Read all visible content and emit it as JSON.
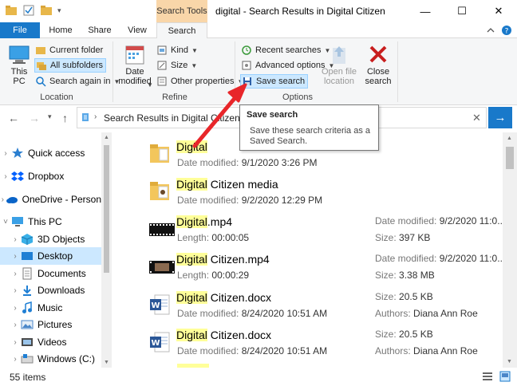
{
  "titlebar": {
    "context_tab": "Search Tools",
    "title": "digital - Search Results in Digital Citizen",
    "minimize": "—",
    "maximize": "☐",
    "close": "✕"
  },
  "tabs": {
    "file": "File",
    "home": "Home",
    "share": "Share",
    "view": "View",
    "search": "Search"
  },
  "ribbon": {
    "location": {
      "this_pc": "This PC",
      "current_folder": "Current folder",
      "all_subfolders": "All subfolders",
      "search_again_in": "Search again in",
      "group_label": "Location"
    },
    "refine": {
      "date_modified": "Date modified",
      "kind": "Kind",
      "size": "Size",
      "other_properties": "Other properties",
      "group_label": "Refine"
    },
    "options": {
      "recent_searches": "Recent searches",
      "advanced_options": "Advanced options",
      "save_search": "Save search",
      "open_file_location": "Open file location",
      "close_search": "Close search",
      "group_label": "Options"
    }
  },
  "address": {
    "path": "Search Results in Digital Citizen"
  },
  "tooltip": {
    "title": "Save search",
    "description": "Save these search criteria as a Saved Search."
  },
  "nav": {
    "items": [
      {
        "label": "Quick access",
        "icon": "star-icon"
      },
      {
        "label": "Dropbox",
        "icon": "dropbox-icon"
      },
      {
        "label": "OneDrive - Person",
        "icon": "cloud-icon"
      },
      {
        "label": "This PC",
        "icon": "computer-icon"
      },
      {
        "label": "3D Objects",
        "icon": "cube-icon"
      },
      {
        "label": "Desktop",
        "icon": "desktop-icon"
      },
      {
        "label": "Documents",
        "icon": "document-icon"
      },
      {
        "label": "Downloads",
        "icon": "download-icon"
      },
      {
        "label": "Music",
        "icon": "music-icon"
      },
      {
        "label": "Pictures",
        "icon": "picture-icon"
      },
      {
        "label": "Videos",
        "icon": "video-icon"
      },
      {
        "label": "Windows (C:)",
        "icon": "drive-icon"
      }
    ]
  },
  "results": [
    {
      "highlight": "Digital",
      "rest": "",
      "sub_label": "Date modified:",
      "sub_value": "9/1/2020 3:26 PM",
      "right1_label": "",
      "right1_value": "",
      "right2_label": "",
      "right2_value": "",
      "icon": "folder-icon"
    },
    {
      "highlight": "Digital",
      "rest": " Citizen media",
      "sub_label": "Date modified:",
      "sub_value": "9/2/2020 12:29 PM",
      "right1_label": "",
      "right1_value": "",
      "right2_label": "",
      "right2_value": "",
      "icon": "folder-media-icon"
    },
    {
      "highlight": "Digital",
      "rest": ".mp4",
      "sub_label": "Length:",
      "sub_value": "00:00:05",
      "right1_label": "Date modified:",
      "right1_value": "9/2/2020 11:0...",
      "right2_label": "Size:",
      "right2_value": "397 KB",
      "icon": "video-file-icon"
    },
    {
      "highlight": "Digital",
      "rest": " Citizen.mp4",
      "sub_label": "Length:",
      "sub_value": "00:00:29",
      "right1_label": "Date modified:",
      "right1_value": "9/2/2020 11:0...",
      "right2_label": "Size:",
      "right2_value": "3.38 MB",
      "icon": "video-file-icon"
    },
    {
      "highlight": "Digital",
      "rest": " Citizen.docx",
      "sub_label": "Date modified:",
      "sub_value": "8/24/2020 10:51 AM",
      "right1_label": "Size:",
      "right1_value": "20.5 KB",
      "right2_label": "Authors:",
      "right2_value": "Diana Ann Roe",
      "icon": "word-doc-icon"
    },
    {
      "highlight": "Digital",
      "rest": " Citizen.docx",
      "sub_label": "Date modified:",
      "sub_value": "8/24/2020 10:51 AM",
      "right1_label": "Size:",
      "right1_value": "20.5 KB",
      "right2_label": "Authors:",
      "right2_value": "Diana Ann Roe",
      "icon": "word-doc-icon"
    }
  ],
  "status": {
    "items": "55 items"
  },
  "colors": {
    "accent": "#1979ca",
    "context_tab": "#f9d6a9",
    "highlight": "#ffff99",
    "selection": "#cce8ff",
    "arrow": "#e8262a"
  }
}
